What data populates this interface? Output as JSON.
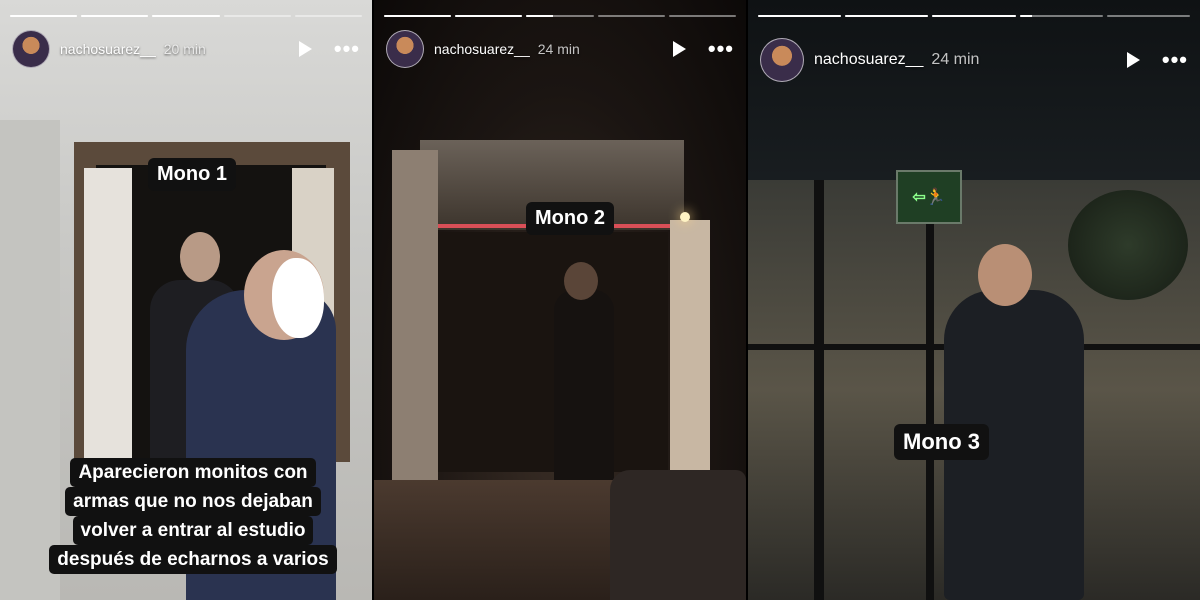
{
  "stories": [
    {
      "username": "nachosuarez__",
      "time": "20 min",
      "progress": [
        1,
        1,
        1,
        0,
        0,
        0
      ],
      "tag": "Mono 1",
      "caption_lines": [
        "Aparecieron monitos con",
        "armas que no nos dejaban",
        "volver a entrar al estudio",
        "después de echarnos a varios"
      ]
    },
    {
      "username": "nachosuarez__",
      "time": "24 min",
      "progress": [
        1,
        1,
        0.4,
        0,
        0
      ],
      "tag": "Mono 2"
    },
    {
      "username": "nachosuarez__",
      "time": "24 min",
      "progress": [
        1,
        1,
        1,
        0.15,
        0
      ],
      "tag": "Mono 3",
      "exit_sign": "⇦🏃"
    }
  ],
  "icons": {
    "play": "play-icon",
    "more": "•••"
  },
  "colors": {
    "tag_bg": "#111111",
    "text": "#ffffff"
  }
}
